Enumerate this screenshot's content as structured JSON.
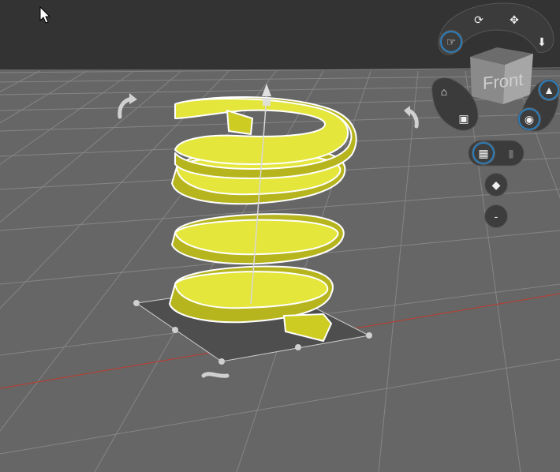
{
  "viewcube": {
    "face_label": "Front"
  },
  "navigation": {
    "orbit_icon": "orbit-icon",
    "pan_icon": "pan-icon",
    "zoom_icon": "zoom-down-icon",
    "home_icon": "home-icon",
    "fit_icon": "fit-view-icon",
    "perspective_icon": "perspective-icon",
    "look_down_icon": "look-down-icon"
  },
  "view_options": {
    "grid_toggle_icon": "grid-icon",
    "trash_icon": "trash-icon",
    "material_icon": "material-icon",
    "minus_label": "-"
  },
  "object": {
    "shape": "helix",
    "color": "#d9d91a"
  },
  "colors": {
    "background": "#666666",
    "top_band": "#333333",
    "grid_line": "#8a8a8a",
    "axis_x": "#c0392b",
    "selection": "#ffffff",
    "accent_blue": "#2a7fbf"
  }
}
